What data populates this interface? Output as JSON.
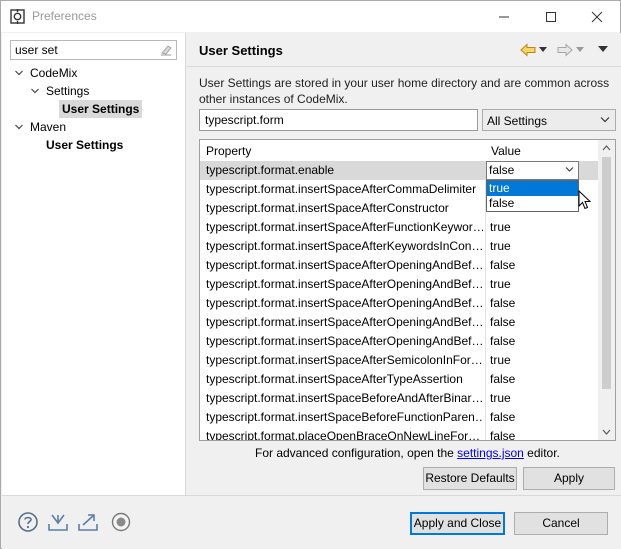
{
  "window": {
    "title": "Preferences"
  },
  "filter": {
    "value": "user set"
  },
  "tree": {
    "codemix": "CodeMix",
    "settings": "Settings",
    "user_settings": "User Settings",
    "maven": "Maven",
    "maven_user_settings": "User Settings"
  },
  "page": {
    "title": "User Settings",
    "description": "User Settings are stored in your user home directory and are common across other instances of CodeMix.",
    "search_value": "typescript.form",
    "scope_selected": "All Settings"
  },
  "table": {
    "headers": {
      "property": "Property",
      "value": "Value"
    },
    "rows": [
      {
        "property": "typescript.format.enable",
        "value": "false"
      },
      {
        "property": "typescript.format.insertSpaceAfterCommaDelimiter",
        "value": "true"
      },
      {
        "property": "typescript.format.insertSpaceAfterConstructor",
        "value": "false"
      },
      {
        "property": "typescript.format.insertSpaceAfterFunctionKeywor…",
        "value": "true"
      },
      {
        "property": "typescript.format.insertSpaceAfterKeywordsInCon…",
        "value": "true"
      },
      {
        "property": "typescript.format.insertSpaceAfterOpeningAndBef…",
        "value": "false"
      },
      {
        "property": "typescript.format.insertSpaceAfterOpeningAndBef…",
        "value": "true"
      },
      {
        "property": "typescript.format.insertSpaceAfterOpeningAndBef…",
        "value": "false"
      },
      {
        "property": "typescript.format.insertSpaceAfterOpeningAndBef…",
        "value": "false"
      },
      {
        "property": "typescript.format.insertSpaceAfterOpeningAndBef…",
        "value": "false"
      },
      {
        "property": "typescript.format.insertSpaceAfterSemicolonInFor…",
        "value": "true"
      },
      {
        "property": "typescript.format.insertSpaceAfterTypeAssertion",
        "value": "false"
      },
      {
        "property": "typescript.format.insertSpaceBeforeAndAfterBinar…",
        "value": "true"
      },
      {
        "property": "typescript.format.insertSpaceBeforeFunctionParen…",
        "value": "false"
      },
      {
        "property": "typescript.format.placeOpenBraceOnNewLineFor…",
        "value": "false"
      }
    ],
    "combo_value": "false",
    "dropdown_options": [
      "true",
      "false"
    ]
  },
  "advanced": {
    "prefix": "For advanced configuration, open the ",
    "link": "settings.json",
    "suffix": " editor."
  },
  "buttons": {
    "restore_defaults": "Restore Defaults",
    "apply": "Apply",
    "apply_and_close": "Apply and Close",
    "cancel": "Cancel"
  },
  "icons": {
    "app": "eclipse-icon",
    "help": "help-icon",
    "import": "import-icon",
    "export": "export-icon",
    "record": "record-icon"
  },
  "colors": {
    "selection": "#0078d7",
    "link": "#0000ee"
  }
}
